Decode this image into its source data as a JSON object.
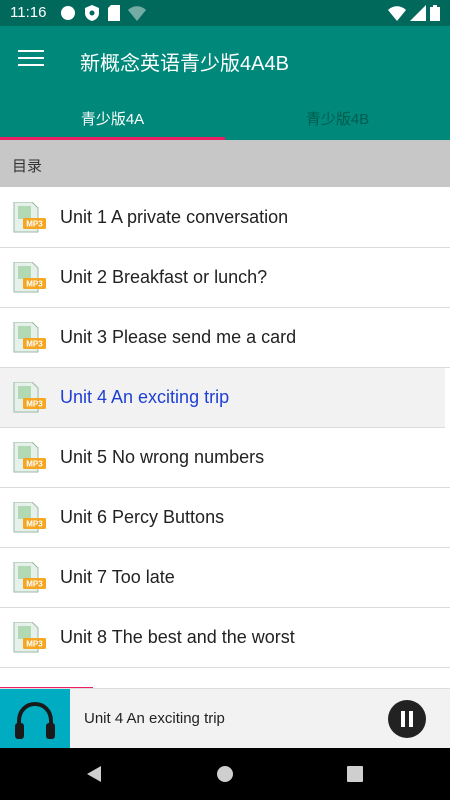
{
  "status_bar": {
    "time": "11:16"
  },
  "app_bar": {
    "title": "新概念英语青少版4A4B"
  },
  "tabs": [
    {
      "label": "青少版4A",
      "selected": true
    },
    {
      "label": "青少版4B",
      "selected": false
    }
  ],
  "section": {
    "title": "目录"
  },
  "list": {
    "items": [
      {
        "label": "Unit 1 A private conversation",
        "icon": "mp3-file-icon"
      },
      {
        "label": "Unit 2 Breakfast or lunch?",
        "icon": "mp3-file-icon"
      },
      {
        "label": "Unit 3 Please send me a card",
        "icon": "mp3-file-icon"
      },
      {
        "label": "Unit 4 An exciting trip",
        "icon": "mp3-file-icon",
        "playing": true
      },
      {
        "label": "Unit 5 No wrong numbers",
        "icon": "mp3-file-icon"
      },
      {
        "label": "Unit 6 Percy Buttons",
        "icon": "mp3-file-icon"
      },
      {
        "label": "Unit 7 Too late",
        "icon": "mp3-file-icon"
      },
      {
        "label": "Unit 8 The best and the worst",
        "icon": "mp3-file-icon"
      }
    ],
    "mp3_badge": "MP3"
  },
  "player": {
    "now_playing": "Unit 4 An exciting trip",
    "state": "playing"
  },
  "colors": {
    "status_bar": "#00695c",
    "app_bar": "#00897b",
    "accent": "#e91e63",
    "active_text": "#1f3fd4",
    "player_cover": "#00acc1"
  }
}
